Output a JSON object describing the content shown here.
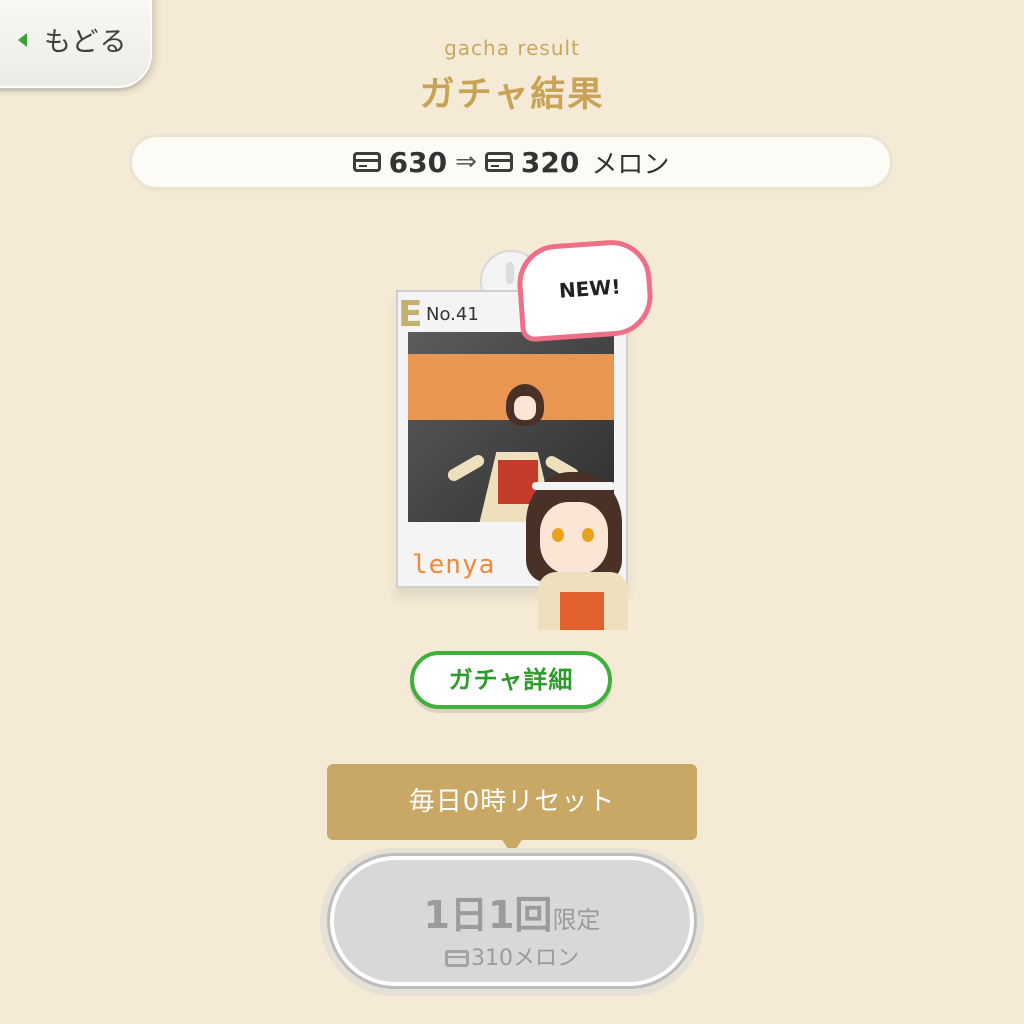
{
  "back": {
    "label": "もどる"
  },
  "header": {
    "subtitle": "gacha result",
    "title": "ガチャ結果"
  },
  "currency": {
    "before": "630",
    "arrow": "⇒",
    "after": "320",
    "unit": "メロン"
  },
  "card": {
    "rank": "E",
    "number": "No.41",
    "name": "lenya",
    "badge": "NEW!"
  },
  "detail_button": {
    "label": "ガチャ詳細"
  },
  "reset_notice": {
    "text": "毎日0時リセット"
  },
  "gacha_button": {
    "count_text": "1日1回",
    "limit_text": "限定",
    "cost": "310",
    "unit": "メロン",
    "state": "disabled"
  },
  "colors": {
    "background": "#f4ead5",
    "gold": "#c8a255",
    "green": "#3fb13a",
    "badge_pink": "#ef6f87",
    "card_orange": "#f29b53"
  }
}
